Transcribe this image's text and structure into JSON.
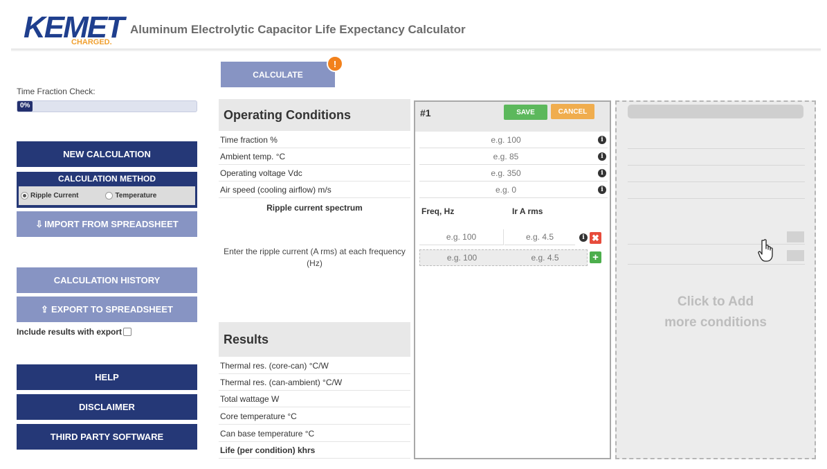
{
  "header": {
    "logo_text": "KEMET",
    "logo_tagline": "CHARGED.",
    "title": "Aluminum Electrolytic Capacitor Life Expectancy Calculator"
  },
  "sidebar": {
    "time_fraction_label": "Time Fraction Check:",
    "progress_percent": 0,
    "progress_text": "0%",
    "new_calculation": "NEW CALCULATION",
    "calculation_method": {
      "title": "CALCULATION METHOD",
      "options": [
        "Ripple Current",
        "Temperature"
      ],
      "selected": "Ripple Current"
    },
    "import_label": "IMPORT FROM SPREADSHEET",
    "history_label": "CALCULATION HISTORY",
    "export_label": "EXPORT TO SPREADSHEET",
    "include_results_label": "Include results with export",
    "include_results_checked": false,
    "help_label": "HELP",
    "disclaimer_label": "DISCLAIMER",
    "third_party_label": "THIRD PARTY SOFTWARE"
  },
  "toolbar": {
    "calculate_label": "CALCULATE",
    "warning_badge": "!"
  },
  "operating_conditions": {
    "heading": "Operating Conditions",
    "rows": [
      "Time fraction %",
      "Ambient temp. °C",
      "Operating voltage Vdc",
      "Air speed (cooling airflow) m/s"
    ],
    "ripple_heading": "Ripple current spectrum",
    "ripple_description": "Enter the ripple current (A rms) at each frequency (Hz)"
  },
  "results": {
    "heading": "Results",
    "rows": [
      "Thermal res. (core-can) °C/W",
      "Thermal res. (can-ambient) °C/W",
      "Total wattage W",
      "Core temperature °C",
      "Can base temperature °C",
      "Life (per condition) khrs"
    ]
  },
  "condition": {
    "number": "#1",
    "save_label": "SAVE",
    "cancel_label": "CANCEL",
    "placeholders": [
      "e.g. 100",
      "e.g. 85",
      "e.g. 350",
      "e.g. 0"
    ],
    "freq_header": "Freq, Hz",
    "current_header": "Ir A rms",
    "ripple_rows": [
      {
        "freq_placeholder": "e.g. 100",
        "current_placeholder": "e.g. 4.5"
      },
      {
        "freq_placeholder": "e.g. 100",
        "current_placeholder": "e.g. 4.5"
      }
    ]
  },
  "add_panel": {
    "text_line1": "Click to Add",
    "text_line2": "more conditions"
  },
  "colors": {
    "navy": "#253877",
    "light_blue": "#8794c3",
    "save_green": "#5cb85c",
    "cancel_orange": "#f0ad4e",
    "warning_orange": "#f2811c",
    "delete_red": "#e74c3c"
  }
}
